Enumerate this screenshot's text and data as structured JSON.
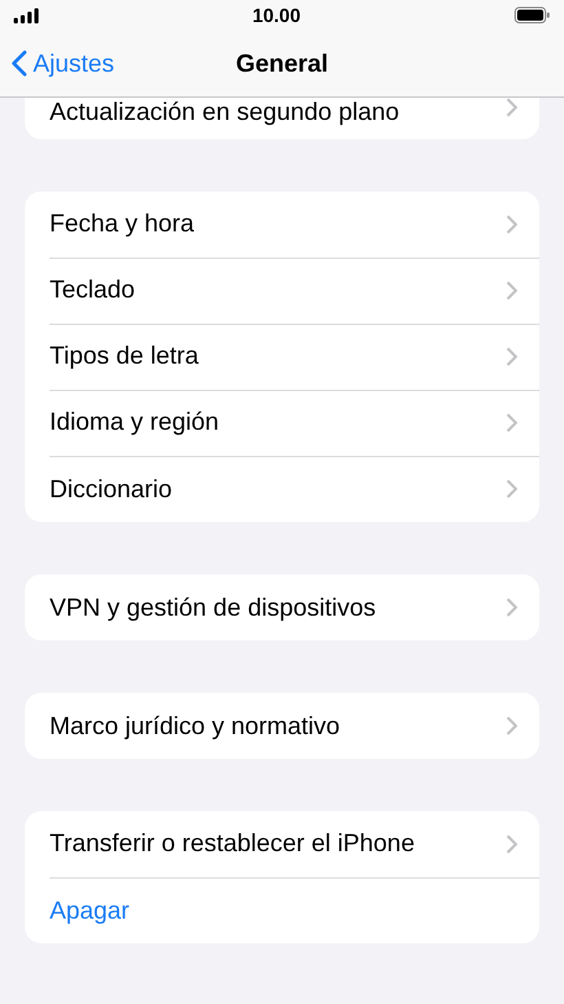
{
  "status_bar": {
    "time": "10.00"
  },
  "nav": {
    "back": "Ajustes",
    "title": "General"
  },
  "groups": [
    {
      "items": [
        {
          "label": "Actualización en segundo plano",
          "kind": "link"
        }
      ]
    },
    {
      "items": [
        {
          "label": "Fecha y hora",
          "kind": "link"
        },
        {
          "label": "Teclado",
          "kind": "link"
        },
        {
          "label": "Tipos de letra",
          "kind": "link"
        },
        {
          "label": "Idioma y región",
          "kind": "link"
        },
        {
          "label": "Diccionario",
          "kind": "link"
        }
      ]
    },
    {
      "items": [
        {
          "label": "VPN y gestión de dispositivos",
          "kind": "link"
        }
      ]
    },
    {
      "items": [
        {
          "label": "Marco jurídico y normativo",
          "kind": "link"
        }
      ]
    },
    {
      "items": [
        {
          "label": "Transferir o restablecer el iPhone",
          "kind": "link"
        },
        {
          "label": "Apagar",
          "kind": "action"
        }
      ]
    }
  ]
}
